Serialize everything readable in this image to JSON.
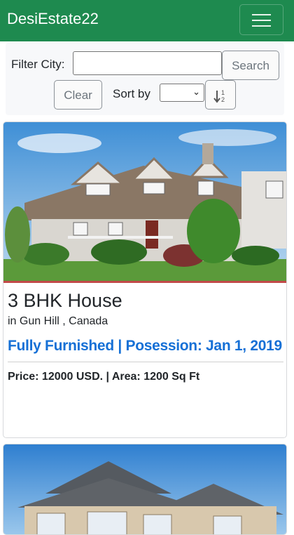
{
  "navbar": {
    "brand": "DesiEstate22",
    "menu_icon": "hamburger-icon",
    "color": "#1e8a4f"
  },
  "filter": {
    "city_label": "Filter City:",
    "city_value": "",
    "search_label": "Search",
    "clear_label": "Clear",
    "sort_label": "Sort by",
    "sort_selected": "",
    "sort_icon": "sort-numeric-ascending-icon"
  },
  "listings": [
    {
      "title": "3 BHK House",
      "location": "in Gun Hill , Canada",
      "highlight": "Fully Furnished | Posession: Jan 1, 2019",
      "details": "Price: 12000 USD. | Area: 1200 Sq Ft",
      "image": "house-photo"
    },
    {
      "title": "",
      "location": "",
      "highlight": "",
      "details": "",
      "image": "house-photo"
    }
  ],
  "colors": {
    "accent": "#1e8a4f",
    "highlight": "#1670d6"
  }
}
